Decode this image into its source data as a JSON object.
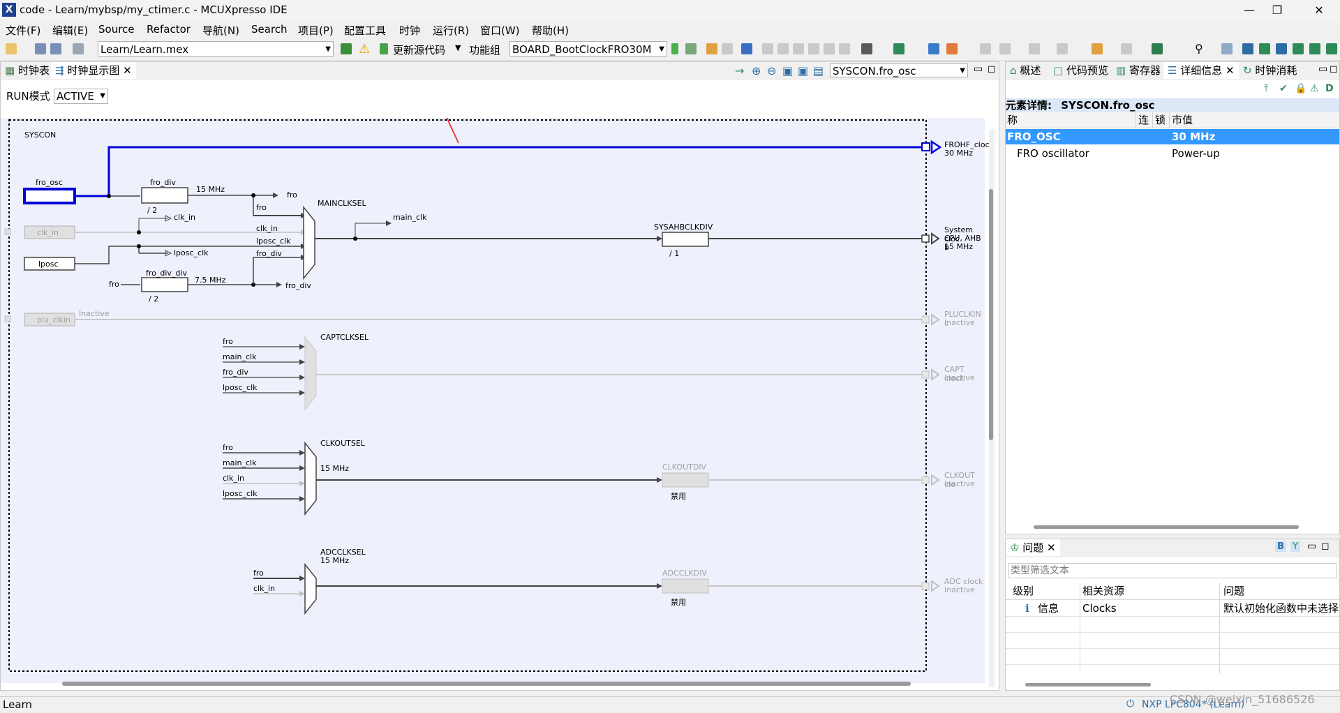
{
  "titlebar": {
    "title": "code - Learn/mybsp/my_ctimer.c - MCUXpresso IDE",
    "min": "—",
    "max": "❐",
    "close": "✕"
  },
  "menu": [
    "文件(F)",
    "编辑(E)",
    "Source",
    "Refactor",
    "导航(N)",
    "Search",
    "项目(P)",
    "配置工具",
    "时钟",
    "运行(R)",
    "窗口(W)",
    "帮助(H)"
  ],
  "toolbar": {
    "project": "Learn/Learn.mex",
    "update_code": "更新源代码",
    "func_group_label": "功能组",
    "func_group_value": "BOARD_BootClockFRO30M"
  },
  "left_tabs": {
    "tab1": "时钟表",
    "tab2": "时钟显示图"
  },
  "diagram_toolbar": {
    "selected_element": "SYSCON.fro_osc"
  },
  "run_mode": {
    "label": "RUN模式",
    "value": "ACTIVE"
  },
  "diagram": {
    "syscon": "SYSCON",
    "fro_osc": "fro_osc",
    "fro_div": "fro_div",
    "div2a": "/ 2",
    "mhz15a": "15 MHz",
    "fro_out": "fro",
    "fro_in1": "fro",
    "mainclksel": "MAINCLKSEL",
    "main_clk": "main_clk",
    "clk_in_box": "clk_in",
    "clk_in_tap": "clk_in",
    "clk_in_mux": "clk_in",
    "lposc_box": "lposc",
    "lposc_clk_tap": "lposc_clk",
    "lposc_clk_mux": "lposc_clk",
    "fro_div_mux": "fro_div",
    "fro_left": "fro",
    "fro_div_div": "fro_div_div",
    "mhz75": "7.5 MHz",
    "div2b": "/ 2",
    "fro_div_out": "fro_div",
    "sysahbclkdiv": "SYSAHBCLKDIV",
    "div1": "/ 1",
    "frohf_out": "FROHF_cloc",
    "frohf_mhz": "30 MHz",
    "sys_out1": "System cloc",
    "sys_out2": "CPU, AHB b",
    "sys_out3": "15 MHz",
    "plu_box": "plu_clkin",
    "inactive1": "Inactive",
    "pluclkin_out": "PLUCLKIN c",
    "pluclkin_inactive": "Inactive",
    "captclksel": "CAPTCLKSEL",
    "capt_in": [
      "fro",
      "main_clk",
      "fro_div",
      "lposc_clk"
    ],
    "capt_out": "CAPT clock",
    "capt_inactive": "Inactive",
    "clkoutsel": "CLKOUTSEL",
    "clkout_in": [
      "fro",
      "main_clk",
      "clk_in",
      "lposc_clk"
    ],
    "clkout_mhz": "15 MHz",
    "clkoutdiv": "CLKOUTDIV",
    "clkout_disabled": "禁用",
    "clkout_out": "CLKOUT clo",
    "clkout_inactive": "Inactive",
    "adcclksel": "ADCCLKSEL",
    "adc_mhz": "15 MHz",
    "adc_in": [
      "fro",
      "clk_in"
    ],
    "adcclkdiv": "ADCCLKDIV",
    "adc_disabled": "禁用",
    "adc_out": "ADC clock",
    "adc_inactive": "Inactive"
  },
  "right_tabs": [
    "概述",
    "代码预览",
    "寄存器",
    "详细信息",
    "时钟消耗"
  ],
  "details": {
    "header_label": "元素详情:",
    "header_value": "SYSCON.fro_osc",
    "col_name": "称",
    "col_link": "连",
    "col_lock": "锁",
    "col_value": "市值",
    "rows": [
      {
        "name": "FRO_OSC",
        "value": "30 MHz"
      },
      {
        "name": "FRO oscillator",
        "value": "Power-up"
      }
    ]
  },
  "problems": {
    "tab": "问题",
    "filter_placeholder": "类型筛选文本",
    "col_level": "级别",
    "col_resource": "相关资源",
    "col_issue": "问题",
    "row": {
      "level": "信息",
      "resource": "Clocks",
      "issue": "默认初始化函数中未选择"
    }
  },
  "status": {
    "left": "Learn",
    "right": "NXP LPC804* (Learn)",
    "watermark": "CSDN @weixin_51686526"
  },
  "colors": {
    "accent": "#0000d8",
    "selection": "#3399ff",
    "arrow": "#e8403a"
  }
}
